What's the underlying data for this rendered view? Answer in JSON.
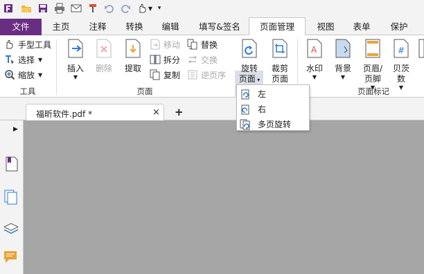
{
  "qat": {
    "icons": [
      "app-logo-icon",
      "open-folder-icon",
      "save-icon",
      "print-icon",
      "email-icon",
      "format-painter-icon",
      "undo-icon",
      "redo-icon",
      "hand-cursor-icon",
      "customize-dropdown-icon"
    ]
  },
  "menu": {
    "file": "文件",
    "tabs": [
      "主页",
      "注释",
      "转换",
      "编辑",
      "填写&签名",
      "页面管理",
      "视图",
      "表单",
      "保护"
    ],
    "active_tab": "页面管理"
  },
  "ribbon": {
    "tools": {
      "hand": "手型工具",
      "select": "选择",
      "zoom": "缩放",
      "group": "工具"
    },
    "pages": {
      "insert": "插入",
      "delete": "删除",
      "extract": "提取",
      "move": "移动",
      "split": "拆分",
      "copy": "复制",
      "replace": "替换",
      "swap": "交换",
      "reverse": "逆页序",
      "group": "页面"
    },
    "rotate": {
      "line1": "旋转",
      "line2": "页面"
    },
    "crop": {
      "line1": "裁剪",
      "line2": "页面"
    },
    "marks": {
      "watermark": "水印",
      "background": "背景",
      "header_line1": "页眉/",
      "header_line2": "页脚",
      "bates_line1": "贝茨",
      "bates_line2": "数",
      "group": "页面标记"
    }
  },
  "dropdown": {
    "items": [
      "左",
      "右",
      "多页旋转"
    ]
  },
  "doc_tab": {
    "title": "福昕软件.pdf *",
    "close": "×",
    "new_tab": "+"
  },
  "colors": {
    "accent": "#6a2d84",
    "blue": "#2e7ad1",
    "canvas": "#a6a6a6"
  }
}
